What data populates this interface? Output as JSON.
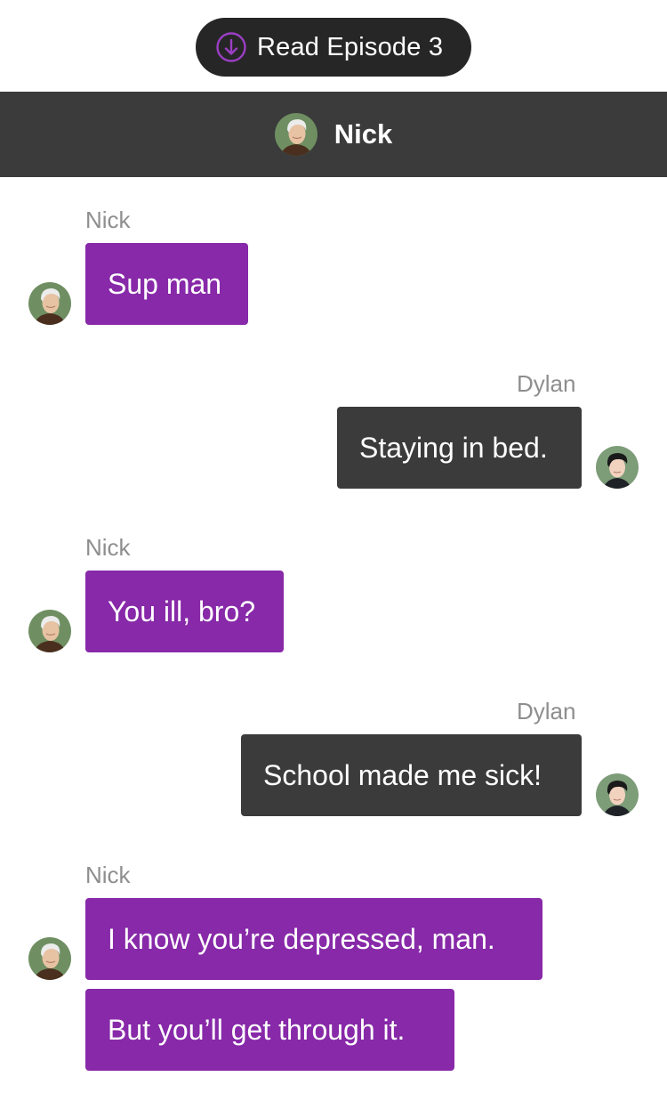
{
  "episode_button": {
    "label": "Read Episode 3",
    "icon": "download-circle-icon",
    "accent_color": "#9b3fc4"
  },
  "header": {
    "title": "Nick",
    "avatar": "nick-avatar"
  },
  "colors": {
    "nick_bubble": "#8729a8",
    "dylan_bubble": "#3b3b3b",
    "header_bar": "#3b3b3b",
    "sender_label": "#8e8e8e"
  },
  "messages": [
    {
      "sender": "Nick",
      "text": "Sup man"
    },
    {
      "sender": "Dylan",
      "text": "Staying in bed."
    },
    {
      "sender": "Nick",
      "text": "You ill, bro?"
    },
    {
      "sender": "Dylan",
      "text": "School made me sick!"
    },
    {
      "sender": "Nick",
      "text": "I know you’re depressed, man."
    },
    {
      "sender": "Nick",
      "text": "But you’ll get through it."
    }
  ]
}
